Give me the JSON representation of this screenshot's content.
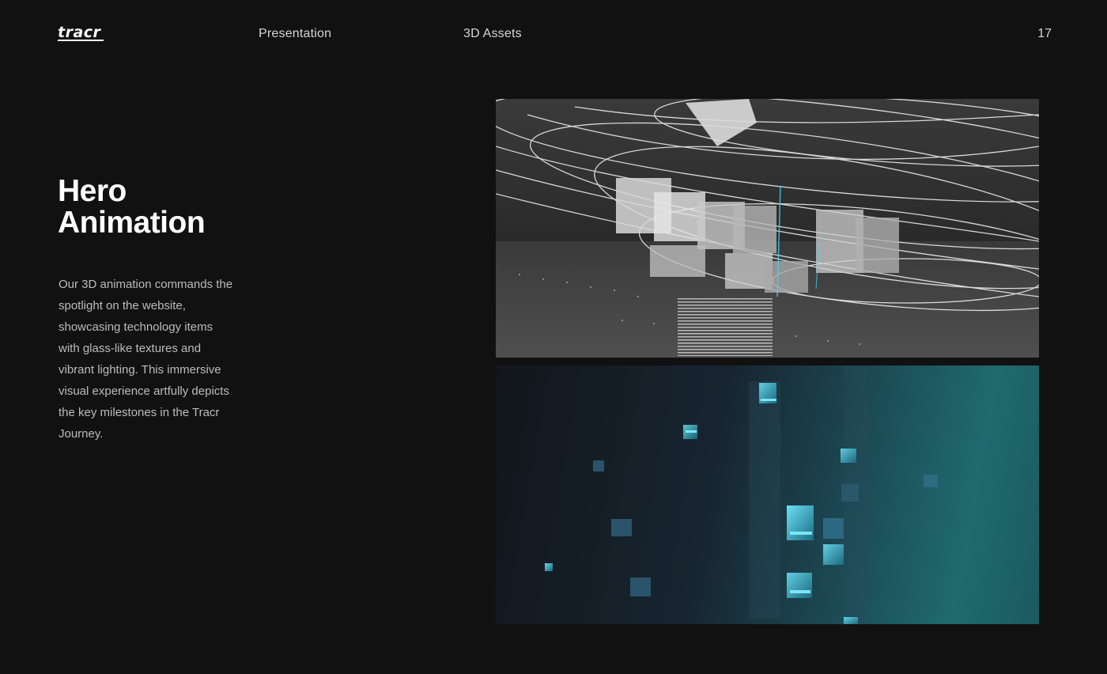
{
  "header": {
    "logo_text": "tracr",
    "nav": [
      {
        "label": "Presentation"
      },
      {
        "label": "3D Assets"
      }
    ],
    "page_number": "17"
  },
  "hero": {
    "title_line1": "Hero",
    "title_line2": "Animation",
    "description": "Our 3D animation commands the spotlight on the website, showcasing technology items with glass-like textures and vibrant lighting. This immersive visual experience artfully depicts the key milestones in the Tracr Journey."
  },
  "colors": {
    "background": "#111112",
    "text": "#ffffff",
    "accent_teal": "#1f6a6e",
    "accent_cyan": "#3fd6ff"
  }
}
